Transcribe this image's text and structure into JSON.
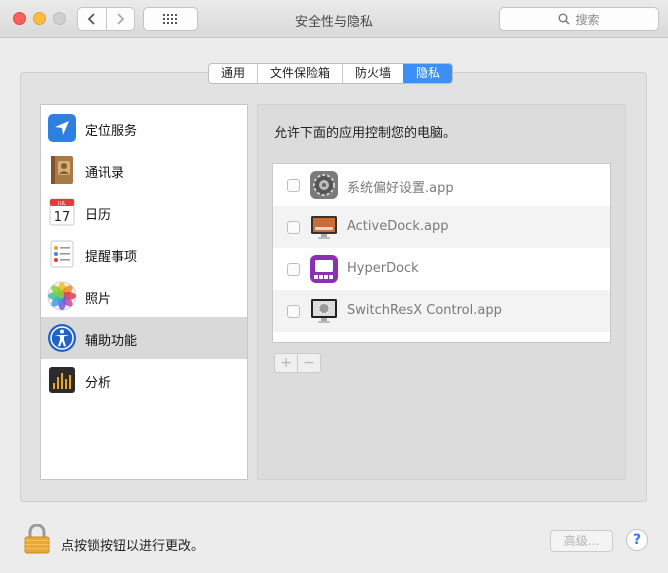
{
  "window": {
    "title": "安全性与隐私",
    "search_placeholder": "搜索"
  },
  "tabs": [
    {
      "label": "通用",
      "active": false
    },
    {
      "label": "文件保险箱",
      "active": false
    },
    {
      "label": "防火墙",
      "active": false
    },
    {
      "label": "隐私",
      "active": true
    }
  ],
  "sidebar": {
    "items": [
      {
        "label": "定位服务",
        "icon": "location-arrow-icon"
      },
      {
        "label": "通讯录",
        "icon": "contacts-book-icon"
      },
      {
        "label": "日历",
        "icon": "calendar-icon",
        "icon_month": "JUL",
        "icon_day": "17"
      },
      {
        "label": "提醒事项",
        "icon": "reminders-icon"
      },
      {
        "label": "照片",
        "icon": "photos-icon"
      },
      {
        "label": "辅助功能",
        "icon": "accessibility-icon",
        "selected": true
      },
      {
        "label": "分析",
        "icon": "analytics-icon"
      }
    ]
  },
  "panel": {
    "title": "允许下面的应用控制您的电脑。",
    "apps": [
      {
        "name": "系统偏好设置.app",
        "checked": false,
        "icon": "system-preferences-icon"
      },
      {
        "name": "ActiveDock.app",
        "checked": false,
        "icon": "activedock-icon"
      },
      {
        "name": "HyperDock",
        "checked": false,
        "icon": "hyperdock-icon"
      },
      {
        "name": "SwitchResX Control.app",
        "checked": false,
        "icon": "switchresx-icon"
      }
    ],
    "add_label": "+",
    "remove_label": "−"
  },
  "footer": {
    "lock_text": "点按锁按钮以进行更改。",
    "advanced_label": "高级...",
    "help_label": "?"
  },
  "colors": {
    "accent": "#3d8ff5",
    "close": "#fc605c",
    "minimize": "#fdbc40"
  }
}
